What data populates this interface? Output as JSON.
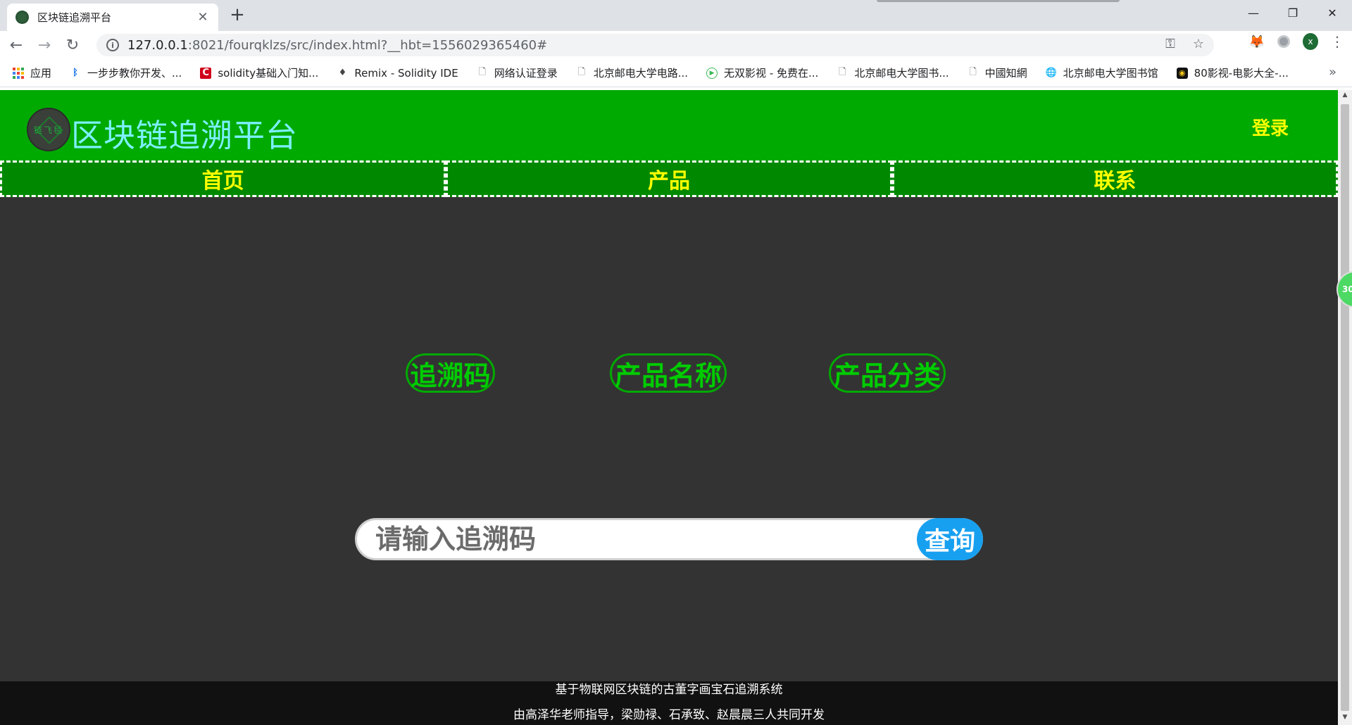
{
  "browser": {
    "tab_title": "区块链追溯平台",
    "tab_close": "✕",
    "new_tab": "+",
    "window": {
      "minimize": "—",
      "restore": "❐",
      "close": "✕"
    },
    "nav": {
      "back": "←",
      "forward": "→",
      "reload": "↻"
    },
    "url": {
      "host": "127.0.0.1",
      "rest": ":8021/fourqklzs/src/index.html?__hbt=1556029365460#"
    },
    "omnibox_icons": {
      "key": "⚿",
      "star": "☆"
    },
    "avatar_letter": "x",
    "menu": "⋮",
    "bookmarks": [
      {
        "label": "应用",
        "icon": "apps"
      },
      {
        "label": "一步步教你开发、...",
        "icon": "bluetooth"
      },
      {
        "label": "solidity基础入门知...",
        "icon": "c-logo"
      },
      {
        "label": "Remix - Solidity IDE",
        "icon": "remix"
      },
      {
        "label": "网络认证登录",
        "icon": "page"
      },
      {
        "label": "北京邮电大学电路...",
        "icon": "page"
      },
      {
        "label": "无双影视 - 免费在...",
        "icon": "play"
      },
      {
        "label": "北京邮电大学图书...",
        "icon": "page"
      },
      {
        "label": "中國知網",
        "icon": "page"
      },
      {
        "label": "北京邮电大学图书馆",
        "icon": "globe"
      },
      {
        "label": "80影视-电影大全-...",
        "icon": "film"
      }
    ],
    "bookmarks_more": "»",
    "side_badge": "30"
  },
  "site": {
    "logo_text": "链飞毯",
    "title": "区块链追溯平台",
    "login": "登录",
    "nav": [
      "首页",
      "产品",
      "联系"
    ],
    "query_tabs": [
      "追溯码",
      "产品名称",
      "产品分类"
    ],
    "search": {
      "placeholder": "请输入追溯码",
      "button": "查询"
    },
    "footer": {
      "line1": "基于物联网区块链的古董字画宝石追溯系统",
      "line2": "由高泽华老师指导，梁勋禄、石承致、赵晨晨三人共同开发"
    }
  },
  "colors": {
    "header_green": "#00aa00",
    "nav_green": "#008800",
    "nav_text": "#ffff00",
    "title_cyan": "#7cf0ff",
    "tab_text": "#00cc00",
    "search_button": "#18a0f0",
    "page_bg": "#333333",
    "footer_bg": "#111111"
  }
}
